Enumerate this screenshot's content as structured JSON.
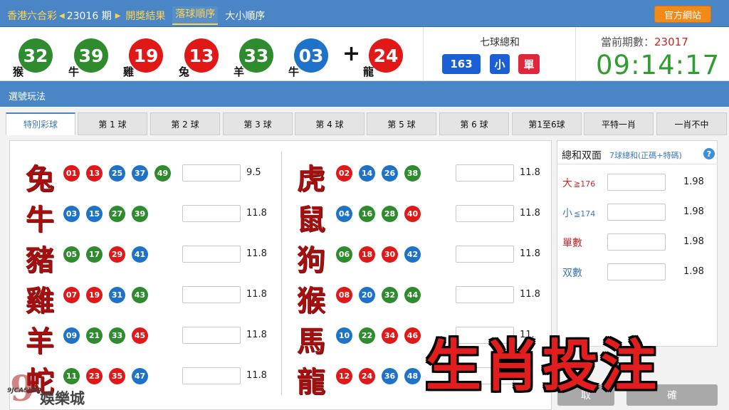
{
  "nav": {
    "lottery": "香港六合彩",
    "period": "23016 期",
    "tabs": [
      "開獎結果",
      "落球順序",
      "大小順序"
    ],
    "official": "官方網站"
  },
  "draw": {
    "balls": [
      {
        "num": "32",
        "zodiac": "猴",
        "color": "#2e8b2e"
      },
      {
        "num": "39",
        "zodiac": "牛",
        "color": "#2e8b2e"
      },
      {
        "num": "19",
        "zodiac": "雞",
        "color": "#e01818"
      },
      {
        "num": "13",
        "zodiac": "兔",
        "color": "#e01818"
      },
      {
        "num": "33",
        "zodiac": "羊",
        "color": "#2e8b2e"
      },
      {
        "num": "03",
        "zodiac": "牛",
        "color": "#1e73c8"
      }
    ],
    "plus": "+",
    "special": {
      "num": "24",
      "zodiac": "龍",
      "color": "#e01818"
    }
  },
  "sum": {
    "title": "七球總和",
    "total": "163",
    "size": "小",
    "parity": "單"
  },
  "current": {
    "label": "當前期數：",
    "period": "23017",
    "time": "09:14:17"
  },
  "section": "選號玩法",
  "tabs": [
    "特別彩球",
    "第 1 球",
    "第 2 球",
    "第 3 球",
    "第 4 球",
    "第 5 球",
    "第 6 球",
    "第1至6球",
    "平特一肖",
    "一肖不中"
  ],
  "left_zodiacs": [
    {
      "zodiac": "兔",
      "odds": "9.5",
      "balls": [
        {
          "n": "01",
          "c": "#e01818"
        },
        {
          "n": "13",
          "c": "#e01818"
        },
        {
          "n": "25",
          "c": "#1e73c8"
        },
        {
          "n": "37",
          "c": "#1e73c8"
        },
        {
          "n": "49",
          "c": "#2e8b2e"
        }
      ]
    },
    {
      "zodiac": "牛",
      "odds": "11.8",
      "balls": [
        {
          "n": "03",
          "c": "#1e73c8"
        },
        {
          "n": "15",
          "c": "#1e73c8"
        },
        {
          "n": "27",
          "c": "#2e8b2e"
        },
        {
          "n": "39",
          "c": "#2e8b2e"
        }
      ]
    },
    {
      "zodiac": "豬",
      "odds": "11.8",
      "balls": [
        {
          "n": "05",
          "c": "#2e8b2e"
        },
        {
          "n": "17",
          "c": "#2e8b2e"
        },
        {
          "n": "29",
          "c": "#e01818"
        },
        {
          "n": "41",
          "c": "#1e73c8"
        }
      ]
    },
    {
      "zodiac": "雞",
      "odds": "11.8",
      "balls": [
        {
          "n": "07",
          "c": "#e01818"
        },
        {
          "n": "19",
          "c": "#e01818"
        },
        {
          "n": "31",
          "c": "#1e73c8"
        },
        {
          "n": "43",
          "c": "#2e8b2e"
        }
      ]
    },
    {
      "zodiac": "羊",
      "odds": "11.8",
      "balls": [
        {
          "n": "09",
          "c": "#1e73c8"
        },
        {
          "n": "21",
          "c": "#2e8b2e"
        },
        {
          "n": "33",
          "c": "#2e8b2e"
        },
        {
          "n": "45",
          "c": "#e01818"
        }
      ]
    },
    {
      "zodiac": "蛇",
      "odds": "11.8",
      "balls": [
        {
          "n": "11",
          "c": "#2e8b2e"
        },
        {
          "n": "23",
          "c": "#e01818"
        },
        {
          "n": "35",
          "c": "#e01818"
        },
        {
          "n": "47",
          "c": "#1e73c8"
        }
      ]
    }
  ],
  "right_zodiacs": [
    {
      "zodiac": "虎",
      "odds": "11.8",
      "balls": [
        {
          "n": "02",
          "c": "#e01818"
        },
        {
          "n": "14",
          "c": "#1e73c8"
        },
        {
          "n": "26",
          "c": "#1e73c8"
        },
        {
          "n": "38",
          "c": "#2e8b2e"
        }
      ]
    },
    {
      "zodiac": "鼠",
      "odds": "11.8",
      "balls": [
        {
          "n": "04",
          "c": "#1e73c8"
        },
        {
          "n": "16",
          "c": "#2e8b2e"
        },
        {
          "n": "28",
          "c": "#2e8b2e"
        },
        {
          "n": "40",
          "c": "#e01818"
        }
      ]
    },
    {
      "zodiac": "狗",
      "odds": "11.8",
      "balls": [
        {
          "n": "06",
          "c": "#2e8b2e"
        },
        {
          "n": "18",
          "c": "#e01818"
        },
        {
          "n": "30",
          "c": "#e01818"
        },
        {
          "n": "42",
          "c": "#1e73c8"
        }
      ]
    },
    {
      "zodiac": "猴",
      "odds": "11.8",
      "balls": [
        {
          "n": "08",
          "c": "#e01818"
        },
        {
          "n": "20",
          "c": "#1e73c8"
        },
        {
          "n": "32",
          "c": "#2e8b2e"
        },
        {
          "n": "44",
          "c": "#2e8b2e"
        }
      ]
    },
    {
      "zodiac": "馬",
      "odds": "11.",
      "balls": [
        {
          "n": "10",
          "c": "#1e73c8"
        },
        {
          "n": "22",
          "c": "#2e8b2e"
        },
        {
          "n": "34",
          "c": "#e01818"
        },
        {
          "n": "46",
          "c": "#e01818"
        }
      ]
    },
    {
      "zodiac": "龍",
      "odds": "",
      "balls": [
        {
          "n": "12",
          "c": "#e01818"
        },
        {
          "n": "24",
          "c": "#e01818"
        },
        {
          "n": "36",
          "c": "#1e73c8"
        },
        {
          "n": "48",
          "c": "#1e73c8"
        }
      ]
    }
  ],
  "side": {
    "title": "總和双面",
    "subtitle": "7球總和(正碼+特碼)",
    "help": "?",
    "rows": [
      {
        "label": "大",
        "cond": "≧176",
        "odds": "1.98",
        "color": "#c62828"
      },
      {
        "label": "小",
        "cond": "≦174",
        "odds": "1.98",
        "color": "#3c77b5"
      },
      {
        "label": "單數",
        "cond": "",
        "odds": "1.98",
        "color": "#c62828"
      },
      {
        "label": "双數",
        "cond": "",
        "odds": "1.98",
        "color": "#3c77b5"
      }
    ]
  },
  "buttons": {
    "cancel": "取",
    "confirm": "確"
  },
  "overlay": {
    "caption": "生肖投注",
    "logo_num": "9",
    "logo_brand": "9JCASINO",
    "logo_cn": "娛樂城"
  }
}
